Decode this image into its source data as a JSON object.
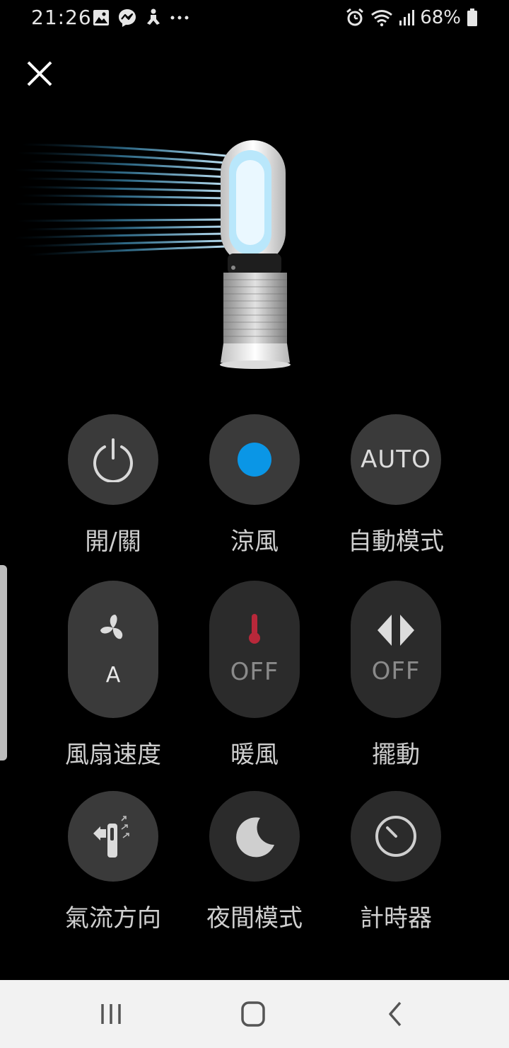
{
  "status": {
    "time": "21:26",
    "battery": "68%",
    "left_icons": [
      "image-icon",
      "messenger-icon",
      "drip-icon",
      "more-icon"
    ],
    "right_icons": [
      "alarm-icon",
      "wifi-icon",
      "signal-icon",
      "battery-icon"
    ]
  },
  "header": {
    "close_icon": "close-icon"
  },
  "controls": [
    {
      "id": "power",
      "label": "開/關",
      "icon": "power-icon"
    },
    {
      "id": "cool",
      "label": "涼風",
      "icon": "blue-dot-icon",
      "accent": "#0a96e6"
    },
    {
      "id": "auto",
      "label": "自動模式",
      "icon_text": "AUTO"
    },
    {
      "id": "fan-speed",
      "label": "風扇速度",
      "icon": "fan-icon",
      "value": "A"
    },
    {
      "id": "heat",
      "label": "暖風",
      "icon": "thermometer-icon",
      "value": "OFF",
      "accent": "#c0283a"
    },
    {
      "id": "oscillation",
      "label": "擺動",
      "icon": "oscillation-icon",
      "value": "OFF"
    },
    {
      "id": "airflow",
      "label": "氣流方向",
      "icon": "airflow-direction-icon"
    },
    {
      "id": "night",
      "label": "夜間模式",
      "icon": "moon-icon"
    },
    {
      "id": "timer",
      "label": "計時器",
      "icon": "timer-icon"
    }
  ],
  "navbar": {
    "icons": [
      "recents-icon",
      "home-icon",
      "back-icon"
    ]
  }
}
